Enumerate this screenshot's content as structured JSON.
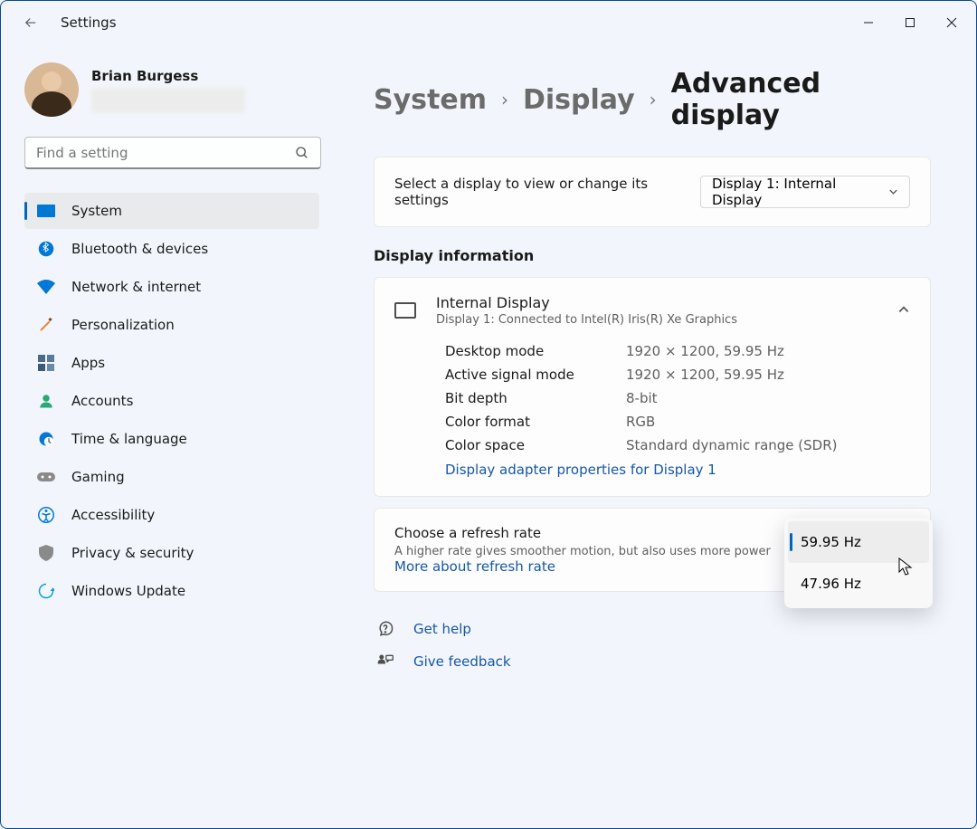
{
  "titlebar": {
    "title": "Settings"
  },
  "user": {
    "name": "Brian Burgess"
  },
  "search": {
    "placeholder": "Find a setting"
  },
  "nav": {
    "system": "System",
    "bluetooth": "Bluetooth & devices",
    "network": "Network & internet",
    "personalization": "Personalization",
    "apps": "Apps",
    "accounts": "Accounts",
    "time": "Time & language",
    "gaming": "Gaming",
    "accessibility": "Accessibility",
    "privacy": "Privacy & security",
    "update": "Windows Update"
  },
  "breadcrumbs": {
    "a": "System",
    "b": "Display",
    "c": "Advanced display"
  },
  "select_display": {
    "label": "Select a display to view or change its settings",
    "value": "Display 1: Internal Display"
  },
  "info_header": "Display information",
  "display": {
    "title": "Internal Display",
    "sub": "Display 1: Connected to Intel(R) Iris(R) Xe Graphics",
    "rows": {
      "desktop_mode_k": "Desktop mode",
      "desktop_mode_v": "1920 × 1200, 59.95 Hz",
      "active_signal_k": "Active signal mode",
      "active_signal_v": "1920 × 1200, 59.95 Hz",
      "bit_depth_k": "Bit depth",
      "bit_depth_v": "8-bit",
      "color_fmt_k": "Color format",
      "color_fmt_v": "RGB",
      "color_space_k": "Color space",
      "color_space_v": "Standard dynamic range (SDR)"
    },
    "adapter_link": "Display adapter properties for Display 1"
  },
  "refresh": {
    "title": "Choose a refresh rate",
    "sub": "A higher rate gives smoother motion, but also uses more power  ",
    "more": "More about refresh rate",
    "options": {
      "a": "59.95 Hz",
      "b": "47.96 Hz"
    }
  },
  "help": {
    "get_help": "Get help",
    "feedback": "Give feedback"
  }
}
